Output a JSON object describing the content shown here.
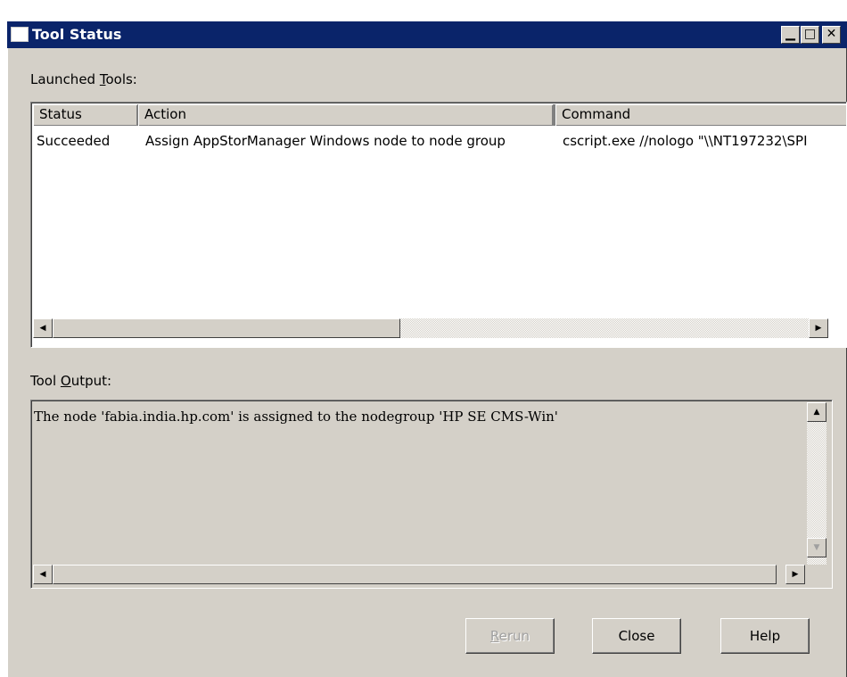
{
  "window": {
    "title": "Tool Status",
    "minimize_glyph": "▁",
    "maximize_glyph": "□",
    "close_glyph": "✕"
  },
  "launched": {
    "label_pre": "Launched ",
    "label_key": "T",
    "label_post": "ools:",
    "columns": [
      "Status",
      "Action",
      "Command"
    ],
    "rows": [
      {
        "status": "Succeeded",
        "action": "Assign AppStorManager Windows node to node group",
        "command": "cscript.exe //nologo \"\\\\NT197232\\SPI"
      }
    ]
  },
  "output": {
    "label_pre": "Tool ",
    "label_key": "O",
    "label_post": "utput:",
    "text": "The node 'fabia.india.hp.com' is assigned to the nodegroup 'HP SE CMS-Win'"
  },
  "buttons": {
    "rerun_key": "R",
    "rerun_rest": "erun",
    "close": "Close",
    "help": "Help"
  },
  "icons": {
    "window": "window-icon",
    "arrow_left": "◀",
    "arrow_right": "▶",
    "arrow_up": "▲",
    "arrow_down": "▼"
  }
}
